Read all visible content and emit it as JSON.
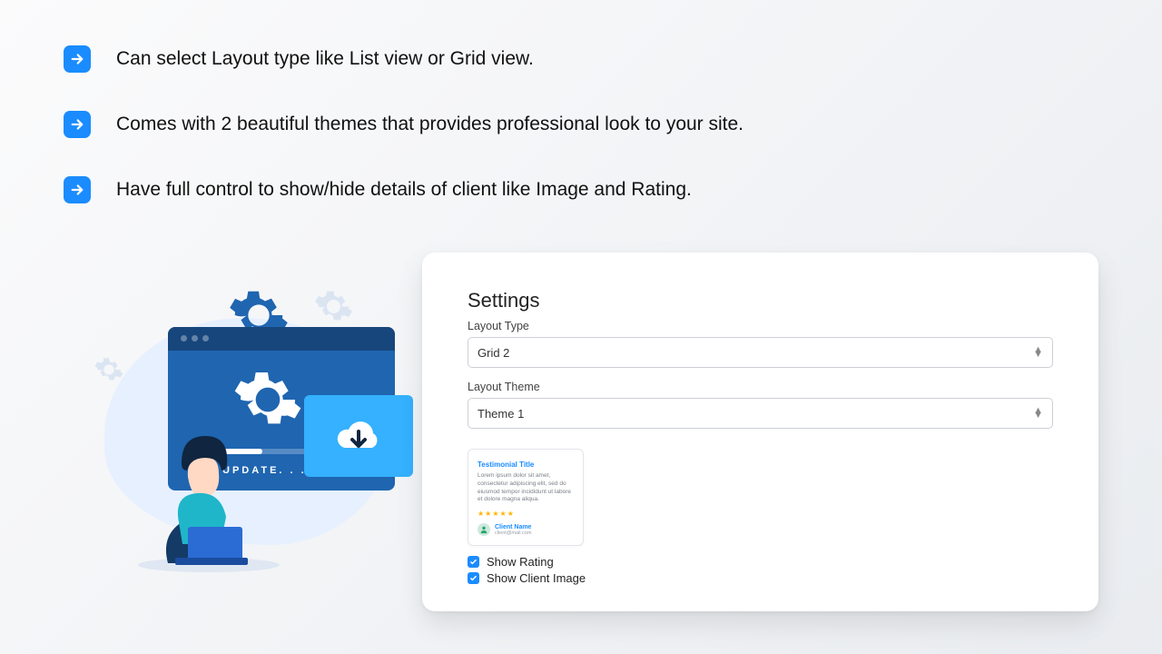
{
  "features": [
    "Can select Layout type like List view or Grid view.",
    "Comes with 2 beautiful themes that provides professional look to your site.",
    "Have full control to show/hide details of client like Image and Rating."
  ],
  "illustration": {
    "update_label": "UPDATE. . . ."
  },
  "settings": {
    "title": "Settings",
    "layout_type": {
      "label": "Layout Type",
      "value": "Grid 2"
    },
    "layout_theme": {
      "label": "Layout Theme",
      "value": "Theme 1"
    },
    "preview": {
      "title": "Testimonial Title",
      "body": "Lorem ipsum dolor sit amet, consectetur adipiscing elit, sed do eiusmod tempor incididunt ut labore et dolore magna aliqua.",
      "stars": "★★★★★",
      "client_name": "Client Name",
      "client_email": "client@mail.com"
    },
    "show_rating": {
      "label": "Show Rating",
      "checked": true
    },
    "show_client_image": {
      "label": "Show Client Image",
      "checked": true
    }
  },
  "colors": {
    "accent": "#1a8cff"
  }
}
